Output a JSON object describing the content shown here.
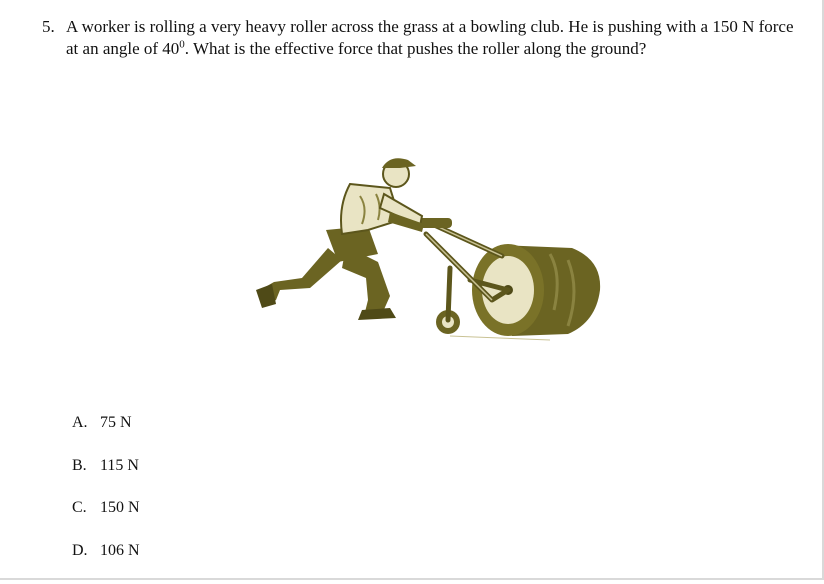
{
  "question": {
    "number": "5.",
    "text_before_sup": "A worker is rolling a very heavy roller across the grass at a bowling club. He is pushing with a 150 N force at an angle of 40",
    "superscript": "0",
    "text_after_sup": ". What is the effective force that pushes the roller along the ground?"
  },
  "illustration": {
    "icon": "worker-pushing-roller-illustration",
    "colors": {
      "olive": "#6b6422",
      "olive_dark": "#4f4a17",
      "light": "#e9e4c4"
    }
  },
  "options": [
    {
      "letter": "A.",
      "value": "75 N"
    },
    {
      "letter": "B.",
      "value": "115 N"
    },
    {
      "letter": "C.",
      "value": "150 N"
    },
    {
      "letter": "D.",
      "value": "106 N"
    }
  ]
}
